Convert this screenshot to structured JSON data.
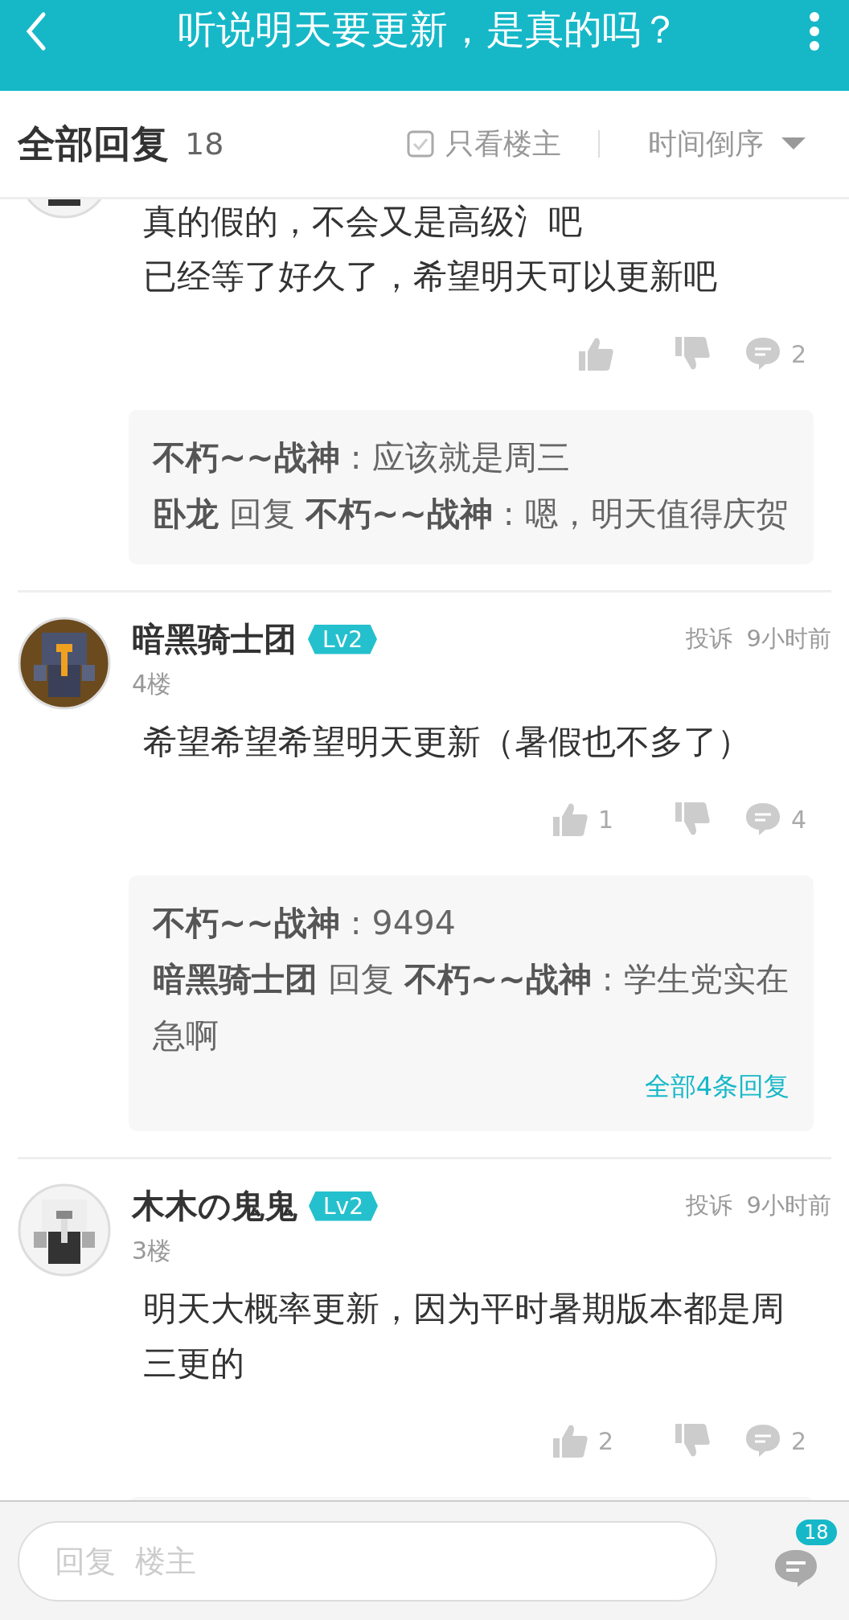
{
  "header": {
    "title": "听说明天要更新，是真的吗？"
  },
  "toolbar": {
    "title": "全部回复",
    "count": "18",
    "owner_filter": {
      "label": "只看楼主",
      "checked": false
    },
    "sort": {
      "label": "时间倒序"
    }
  },
  "comments": [
    {
      "kind": "partial",
      "body": [
        "真的假的，不会又是高级氵吧",
        "已经等了好久了，希望明天可以更新吧"
      ],
      "comments": "2",
      "replies": [
        "**不朽~~战神** : 应该就是周三",
        "**卧龙** 回复 **不朽~~战神** : 嗯，明天值得庆贺"
      ]
    },
    {
      "kind": "full",
      "name": "暗黑骑士团",
      "level": "Lv2",
      "report": "投诉",
      "time": "9小时前",
      "floor": "4楼",
      "body": [
        "希望希望希望明天更新（暑假也不多了）"
      ],
      "likes": "1",
      "comments": "4",
      "replies": [
        "**不朽~~战神** : 9494",
        "**暗黑骑士团** 回复 **不朽~~战神** : 学生党实在急啊"
      ],
      "more": "全部4条回复"
    },
    {
      "kind": "full",
      "name": "木木の鬼鬼",
      "level": "Lv2",
      "report": "投诉",
      "time": "9小时前",
      "floor": "3楼",
      "body": [
        "明天大概率更新，因为平时暑期版本都是周三更的"
      ],
      "likes": "2",
      "comments": "2"
    }
  ],
  "bottom_bar": {
    "placeholder": "回复  楼主",
    "badge": "18"
  }
}
